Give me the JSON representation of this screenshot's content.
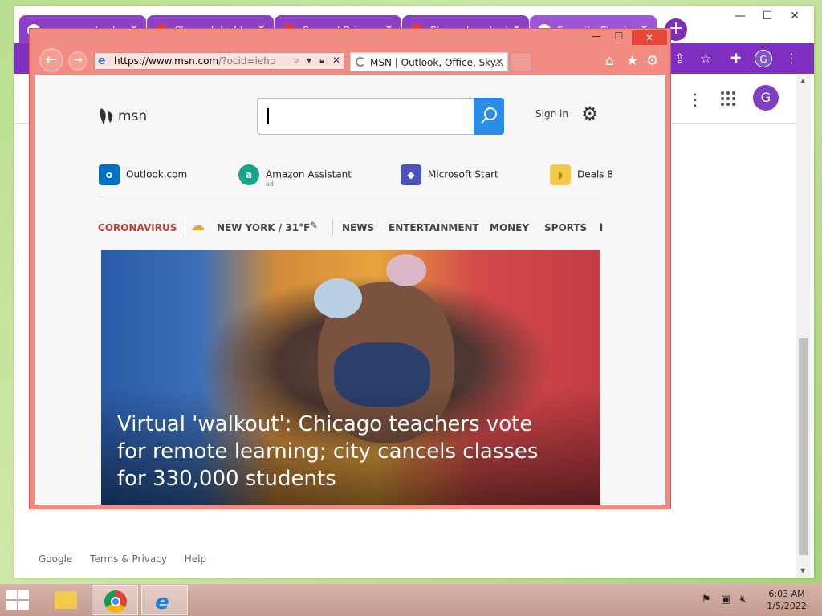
{
  "chrome": {
    "tabs": [
      {
        "label": "orangecodecdev"
      },
      {
        "label": "Channel dashbo"
      },
      {
        "label": "General Drian"
      },
      {
        "label": "Channel content"
      },
      {
        "label": "Security Checkup"
      }
    ],
    "avatar_letter": "G",
    "page_avatar_letter": "G",
    "footer": {
      "google": "Google",
      "terms": "Terms & Privacy",
      "help": "Help"
    }
  },
  "ie": {
    "address": {
      "host": "https://www.msn.com",
      "path": "/?ocid=iehp"
    },
    "tab_title": "MSN | Outlook, Office, Sky...",
    "page": {
      "brand": "msn",
      "search_placeholder": "",
      "sign_in": "Sign in",
      "quick_links": [
        {
          "label": "Outlook.com",
          "icon": "outlook-icon",
          "color": "#0072c6"
        },
        {
          "label": "Amazon Assistant",
          "icon": "amazon-icon",
          "color": "#17a589",
          "ad": "ad"
        },
        {
          "label": "Microsoft Start",
          "icon": "microsoft-start-icon",
          "color": "#4b53bc"
        },
        {
          "label": "Deals 8",
          "icon": "deals-icon",
          "color": "#f2c94c"
        }
      ],
      "nav": {
        "coronavirus": "CORONAVIRUS",
        "weather": "NEW YORK / 31°F",
        "news": "NEWS",
        "entertainment": "ENTERTAINMENT",
        "money": "MONEY",
        "sports": "SPORTS",
        "more": "l"
      },
      "hero_title": "Virtual 'walkout': Chicago teachers vote for remote learning; city cancels classes for 330,000 students"
    }
  },
  "taskbar": {
    "time": "6:03 AM",
    "date": "1/5/2022"
  },
  "colors": {
    "chrome_theme": "#7e2fbf",
    "ie_frame": "#f28b82",
    "msn_search_button": "#2a8ee8",
    "coronavirus": "#b53a2f"
  }
}
